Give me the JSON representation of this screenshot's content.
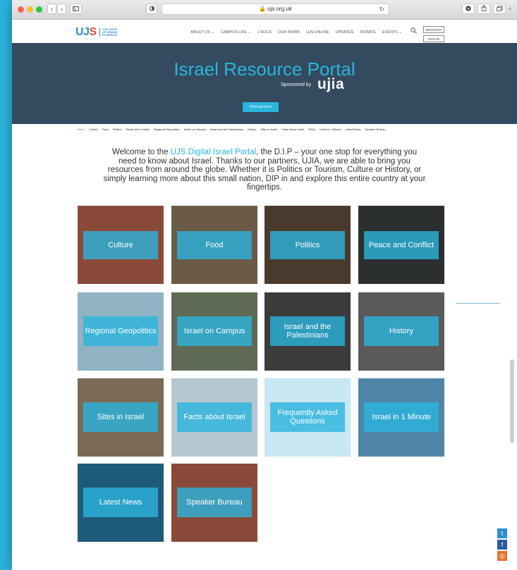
{
  "browser": {
    "url": "ujs.org.uk",
    "nav_back": "‹",
    "nav_forward": "›",
    "reload": "↻"
  },
  "site": {
    "logo_text": [
      "U",
      "J",
      "S"
    ],
    "logo_tagline": "THE VOICE OF JEWISH STUDENTS",
    "nav": [
      "ABOUT US",
      "CAMPUS LIFE",
      "J-SOCS",
      "OUR WORK",
      "UJS-ONLINE",
      "UPDATES",
      "DONATE",
      "EVENTS"
    ],
    "register": "REGISTER",
    "sign_in": "SIGN IN"
  },
  "hero": {
    "title": "Israel Resource Portal",
    "sponsored_by": "Sponsored by",
    "sponsor_logo": "ujia",
    "button": "Find out more"
  },
  "subnav": [
    "Home",
    "Culture",
    "Food",
    "Politics",
    "Peace and Conflict",
    "Regional Geopolitics",
    "Israel on Campus",
    "Israel and the Palestinians",
    "History",
    "Sites in Israel",
    "Facts about Israel",
    "FAQs",
    "Israel in 1 Minute",
    "Latest News",
    "Speaker Bureau"
  ],
  "intro": {
    "before": "Welcome to the ",
    "highlight": "UJS Digital Israel Portal",
    "after": ", the D.I.P – your one stop for everything you need to know about Israel. Thanks to our partners, UJIA, we are able to bring you resources from around the globe. Whether it is Politics or Tourism, Culture or History, or simply learning more about this small nation, DIP in and explore this entire country at your fingertips."
  },
  "tiles": [
    {
      "label": "Culture",
      "bg": "#8a4a3a"
    },
    {
      "label": "Food",
      "bg": "#6b5a45"
    },
    {
      "label": "Politics",
      "bg": "#4a3a2e"
    },
    {
      "label": "Peace and Conflict",
      "bg": "#2b2f2f"
    },
    {
      "label": "Regional Geopolitics",
      "bg": "#8fb3c2"
    },
    {
      "label": "Israel on Campus",
      "bg": "#5f6a54"
    },
    {
      "label": "Israel and the Palestinians",
      "bg": "#3b3b3b"
    },
    {
      "label": "History",
      "bg": "#5a5a5a"
    },
    {
      "label": "Sites in Israel",
      "bg": "#7a6a55"
    },
    {
      "label": "Facts about Israel",
      "bg": "#b5c7cf"
    },
    {
      "label": "Frequently Asked Questions",
      "bg": "#c7e7f2"
    },
    {
      "label": "Israel in 1 Minute",
      "bg": "#4f86a8"
    },
    {
      "label": "Latest News",
      "bg": "#1e5a7a"
    },
    {
      "label": "Speaker Bureau",
      "bg": "#8a4a3a"
    }
  ],
  "social": [
    {
      "icon": "twitter-icon",
      "glyph": "t",
      "color": "#2c8fd0"
    },
    {
      "icon": "facebook-icon",
      "glyph": "f",
      "color": "#2b5aa5"
    },
    {
      "icon": "instagram-icon",
      "glyph": "◎",
      "color": "#e8722c"
    }
  ]
}
